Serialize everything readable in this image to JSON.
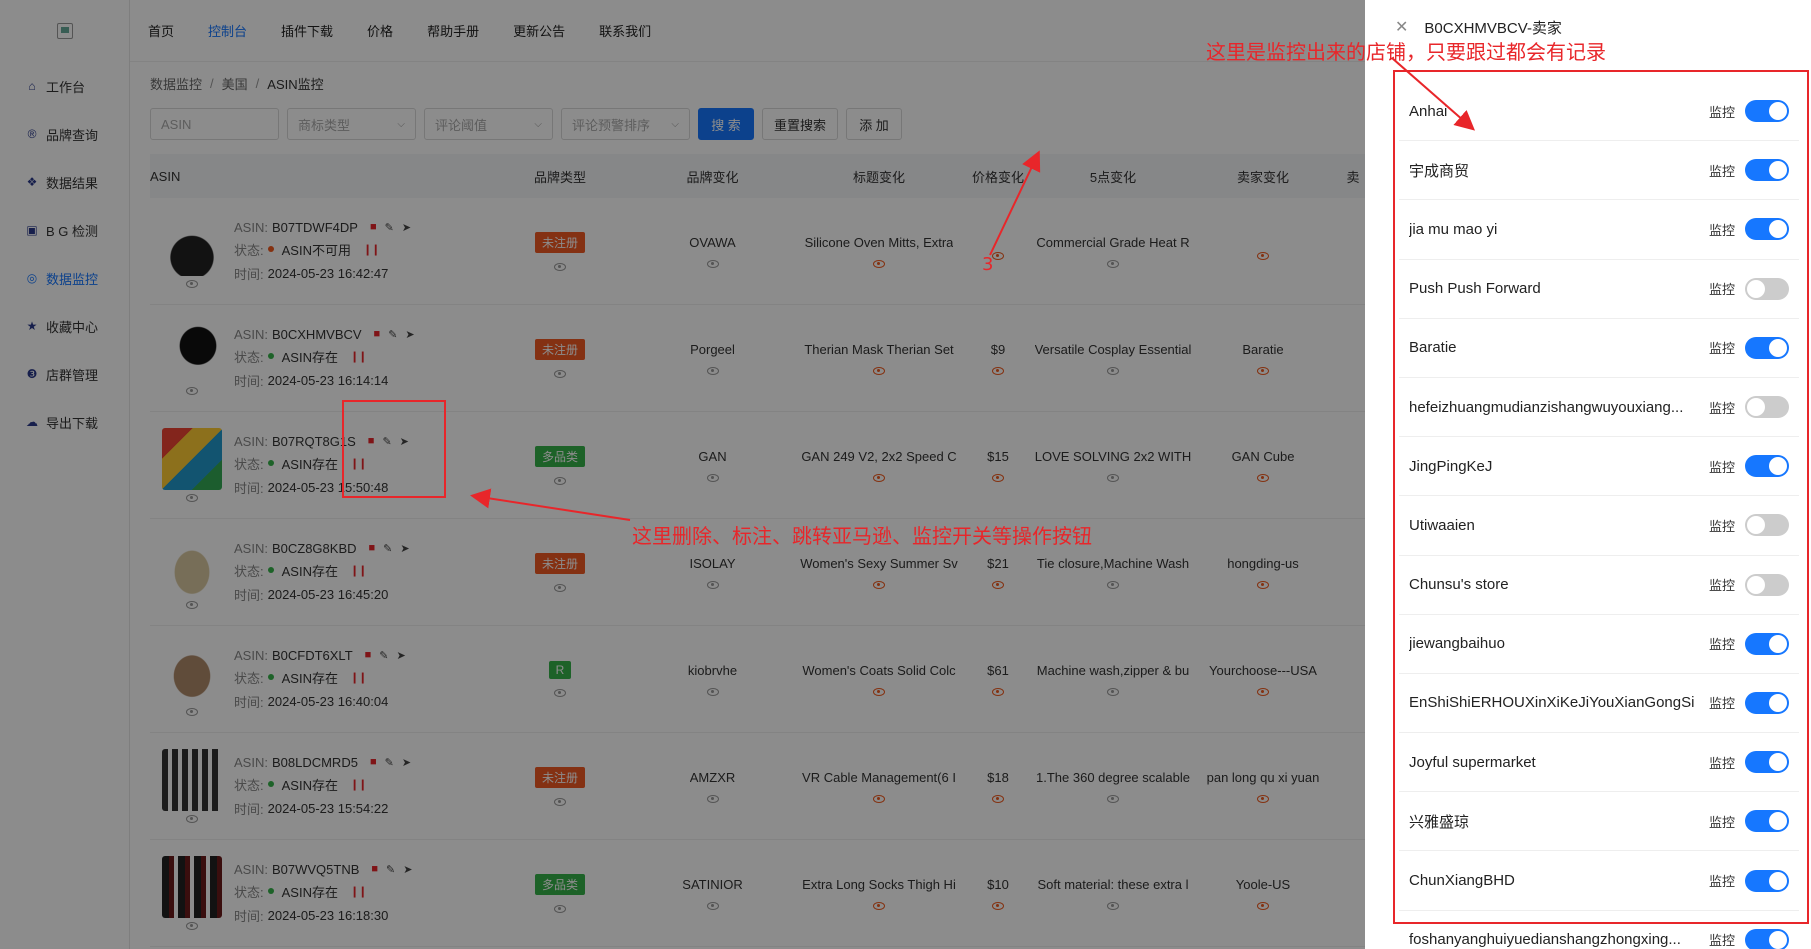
{
  "sidebar": {
    "items": [
      {
        "label": "工作台",
        "icon": "home-icon"
      },
      {
        "label": "品牌查询",
        "icon": "registered-icon"
      },
      {
        "label": "数据结果",
        "icon": "cubes-icon"
      },
      {
        "label": "B G 检测",
        "icon": "detect-icon"
      },
      {
        "label": "数据监控",
        "icon": "monitor-icon"
      },
      {
        "label": "收藏中心",
        "icon": "star-icon"
      },
      {
        "label": "店群管理",
        "icon": "store-icon"
      },
      {
        "label": "导出下载",
        "icon": "cloud-download-icon"
      }
    ]
  },
  "topnav": {
    "items": [
      "首页",
      "控制台",
      "插件下载",
      "价格",
      "帮助手册",
      "更新公告",
      "联系我们"
    ]
  },
  "breadcrumb": {
    "a": "数据监控",
    "b": "美国",
    "c": "ASIN监控"
  },
  "filters": {
    "asin_placeholder": "ASIN",
    "brand_type": "商标类型",
    "review_threshold": "评论阈值",
    "review_sort": "评论预警排序",
    "search": "搜 索",
    "reset": "重置搜索",
    "add": "添 加"
  },
  "table": {
    "headers": [
      "ASIN",
      "品牌类型",
      "品牌变化",
      "标题变化",
      "价格变化",
      "5点变化",
      "卖家变化",
      "卖"
    ],
    "label_asin": "ASIN:",
    "label_status": "状态:",
    "label_time": "时间:",
    "rows": [
      {
        "asin": "B07TDWF4DP",
        "status": "ASIN不可用",
        "status_color": "#f05a1e",
        "time": "2024-05-23 16:42:47",
        "brand_type": "未注册",
        "tag_color": "orange",
        "brand": "OVAWA",
        "title": "Silicone Oven Mitts, Extra",
        "price": "",
        "bullets": "Commercial Grade Heat R",
        "seller": ""
      },
      {
        "asin": "B0CXHMVBCV",
        "status": "ASIN存在",
        "status_color": "#36b24a",
        "time": "2024-05-23 16:14:14",
        "brand_type": "未注册",
        "tag_color": "orange",
        "brand": "Porgeel",
        "title": "Therian Mask Therian Set",
        "price": "$9",
        "bullets": "Versatile Cosplay Essential",
        "seller": "Baratie"
      },
      {
        "asin": "B07RQT8G1S",
        "status": "ASIN存在",
        "status_color": "#36b24a",
        "time": "2024-05-23 15:50:48",
        "brand_type": "多品类",
        "tag_color": "green",
        "brand": "GAN",
        "title": "GAN 249 V2, 2x2 Speed C",
        "price": "$15",
        "bullets": "LOVE SOLVING 2x2 WITH",
        "seller": "GAN Cube"
      },
      {
        "asin": "B0CZ8G8KBD",
        "status": "ASIN存在",
        "status_color": "#36b24a",
        "time": "2024-05-23 16:45:20",
        "brand_type": "未注册",
        "tag_color": "orange",
        "brand": "ISOLAY",
        "title": "Women's Sexy Summer Sv",
        "price": "$21",
        "bullets": "Tie closure,Machine Wash",
        "seller": "hongding-us"
      },
      {
        "asin": "B0CFDT6XLT",
        "status": "ASIN存在",
        "status_color": "#36b24a",
        "time": "2024-05-23 16:40:04",
        "brand_type": "R",
        "tag_color": "green",
        "brand": "kiobrvhe",
        "title": "Women's Coats Solid Colc",
        "price": "$61",
        "bullets": "Machine wash,zipper & bu",
        "seller": "Yourchoose---USA"
      },
      {
        "asin": "B08LDCMRD5",
        "status": "ASIN存在",
        "status_color": "#36b24a",
        "time": "2024-05-23 15:54:22",
        "brand_type": "未注册",
        "tag_color": "orange",
        "brand": "AMZXR",
        "title": "VR Cable Management(6 I",
        "price": "$18",
        "bullets": "1.The 360 degree scalable",
        "seller": "pan long qu xi yuan"
      },
      {
        "asin": "B07WVQ5TNB",
        "status": "ASIN存在",
        "status_color": "#36b24a",
        "time": "2024-05-23 16:18:30",
        "brand_type": "多品类",
        "tag_color": "green",
        "brand": "SATINIOR",
        "title": "Extra Long Socks Thigh Hi",
        "price": "$10",
        "bullets": "Soft material: these extra l",
        "seller": "Yoole-US"
      }
    ]
  },
  "drawer": {
    "title": "B0CXHMVBCV-卖家",
    "monitor_label": "监控",
    "sellers": [
      {
        "name": "Anhai",
        "on": true
      },
      {
        "name": "宇成商贸",
        "on": true
      },
      {
        "name": "jia mu mao yi",
        "on": true
      },
      {
        "name": "Push Push Forward",
        "on": false
      },
      {
        "name": "Baratie",
        "on": true
      },
      {
        "name": "hefeizhuangmudianzishangwuyouxiang...",
        "on": false
      },
      {
        "name": "JingPingKeJ",
        "on": true
      },
      {
        "name": "Utiwaaien",
        "on": false
      },
      {
        "name": "Chunsu's store",
        "on": false
      },
      {
        "name": "jiewangbaihuo",
        "on": true
      },
      {
        "name": "EnShiShiERHOUXinXiKeJiYouXianGongSi",
        "on": true
      },
      {
        "name": "Joyful supermarket",
        "on": true
      },
      {
        "name": "兴雅盛琼",
        "on": true
      },
      {
        "name": "ChunXiangBHD",
        "on": true
      },
      {
        "name": "foshanyanghuiyuedianshangzhongxing...",
        "on": true
      }
    ]
  },
  "annotations": {
    "store_note": "这里是监控出来的店铺，只要跟过都会有记录",
    "ops_note": "这里删除、标注、跳转亚马逊、监控开关等操作按钮",
    "num3": "3"
  },
  "colors": {
    "primary": "#1677ff",
    "annotation": "#e8262a",
    "tag_orange": "#f15a24",
    "tag_green": "#36b24a"
  }
}
